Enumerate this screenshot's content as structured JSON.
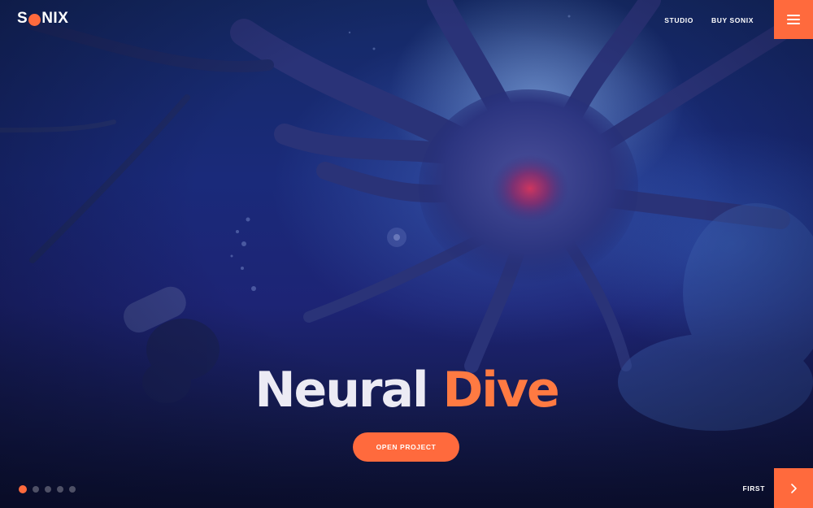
{
  "brand": {
    "logo_left": "S",
    "logo_right": "NIX",
    "accent_color": "#ff6a3d"
  },
  "nav": {
    "items": [
      {
        "label": "STUDIO"
      },
      {
        "label": "BUY SONIX"
      }
    ],
    "menu_icon": "hamburger-icon"
  },
  "hero": {
    "title_word1": "Neural",
    "title_word2": "Dive",
    "cta_label": "OPEN PROJECT"
  },
  "pagination": {
    "count": 5,
    "active_index": 0
  },
  "footer": {
    "next_label": "FIRST",
    "next_icon": "chevron-right-icon"
  }
}
